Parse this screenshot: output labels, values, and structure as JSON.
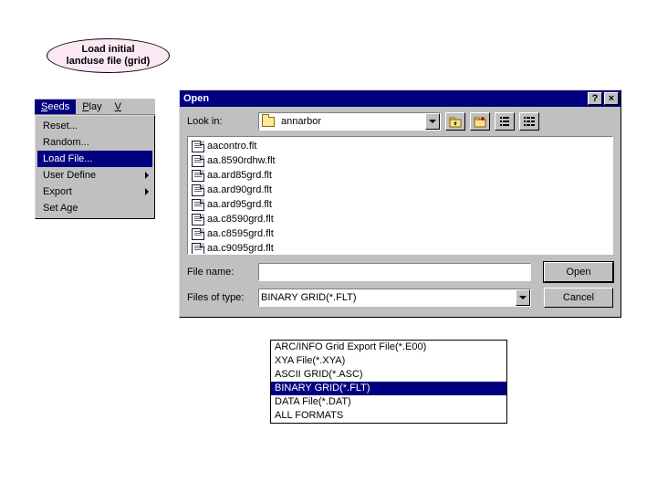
{
  "annotation": {
    "line1": "Load initial",
    "line2": "landuse file (grid)"
  },
  "menubar": {
    "seeds": "Seeds",
    "play": "Play",
    "view_frag": "V"
  },
  "dropdown": {
    "items": [
      {
        "label": "Reset...",
        "submenu": false
      },
      {
        "label": "Random...",
        "submenu": false
      },
      {
        "label": "Load File...",
        "submenu": false
      },
      {
        "label": "User Define",
        "submenu": true
      },
      {
        "label": "Export",
        "submenu": true
      },
      {
        "label": "Set Age",
        "submenu": false
      }
    ],
    "selected_index": 2
  },
  "opendlg": {
    "title": "Open",
    "help_btn": "?",
    "close_btn": "×",
    "lookin_label": "Look in:",
    "lookin_value": "annarbor",
    "files": [
      "aacontro.flt",
      "aa.8590rdhw.flt",
      "aa.ard85grd.flt",
      "aa.ard90grd.flt",
      "aa.ard95grd.flt",
      "aa.c8590grd.flt",
      "aa.c8595grd.flt",
      "aa.c9095grd.flt"
    ],
    "filename_label": "File name:",
    "filename_value": "",
    "filetype_label": "Files of type:",
    "filetype_value": "BINARY GRID(*.FLT)",
    "open_btn": "Open",
    "cancel_btn": "Cancel",
    "type_options": [
      "ARC/INFO Grid Export File(*.E00)",
      "XYA File(*.XYA)",
      "ASCII GRID(*.ASC)",
      "BINARY GRID(*.FLT)",
      "DATA File(*.DAT)",
      "ALL FORMATS"
    ],
    "type_selected_index": 3
  }
}
